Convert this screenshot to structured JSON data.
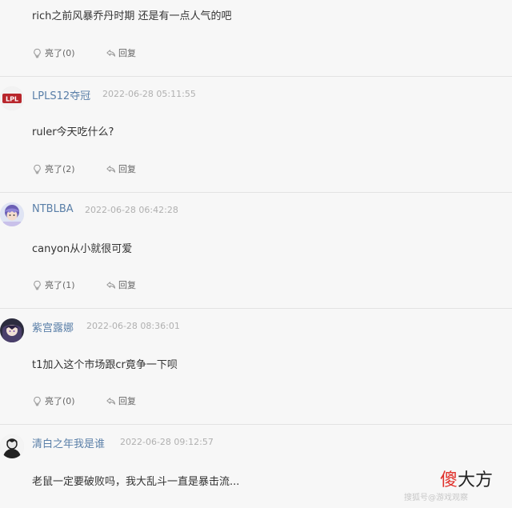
{
  "comments": [
    {
      "username": "",
      "time": "",
      "text": "rich之前风暴乔丹时期 还是有一点人气的吧",
      "like_label": "亮了(0)",
      "reply_label": "回复"
    },
    {
      "username": "LPLS12夺冠",
      "time": "2022-06-28 05:11:55",
      "text": "ruler今天吃什么?",
      "like_label": "亮了(2)",
      "reply_label": "回复",
      "avatar_text": "LPL"
    },
    {
      "username": "NTBLBA",
      "time": "2022-06-28 06:42:28",
      "text": "canyon从小就很可爱",
      "like_label": "亮了(1)",
      "reply_label": "回复"
    },
    {
      "username": "紫宫露娜",
      "time": "2022-06-28 08:36:01",
      "text": "t1加入这个市场跟cr竟争一下呗",
      "like_label": "亮了(0)",
      "reply_label": "回复"
    },
    {
      "username": "清白之年我是谁",
      "time": "2022-06-28 09:12:57",
      "text": "老鼠一定要破败吗，我大乱斗一直是暴击流...",
      "like_label": "",
      "reply_label": ""
    }
  ],
  "watermark": {
    "brand_red": "傻",
    "brand_rest": "大方",
    "sub": "搜狐号@游戏观察"
  },
  "colors": {
    "username": "#5a7fa8",
    "time": "#b0b0b0",
    "watermark_red": "#e0302a"
  },
  "icons": {
    "like": "lightbulb-like-icon",
    "reply": "reply-arrow-icon"
  }
}
